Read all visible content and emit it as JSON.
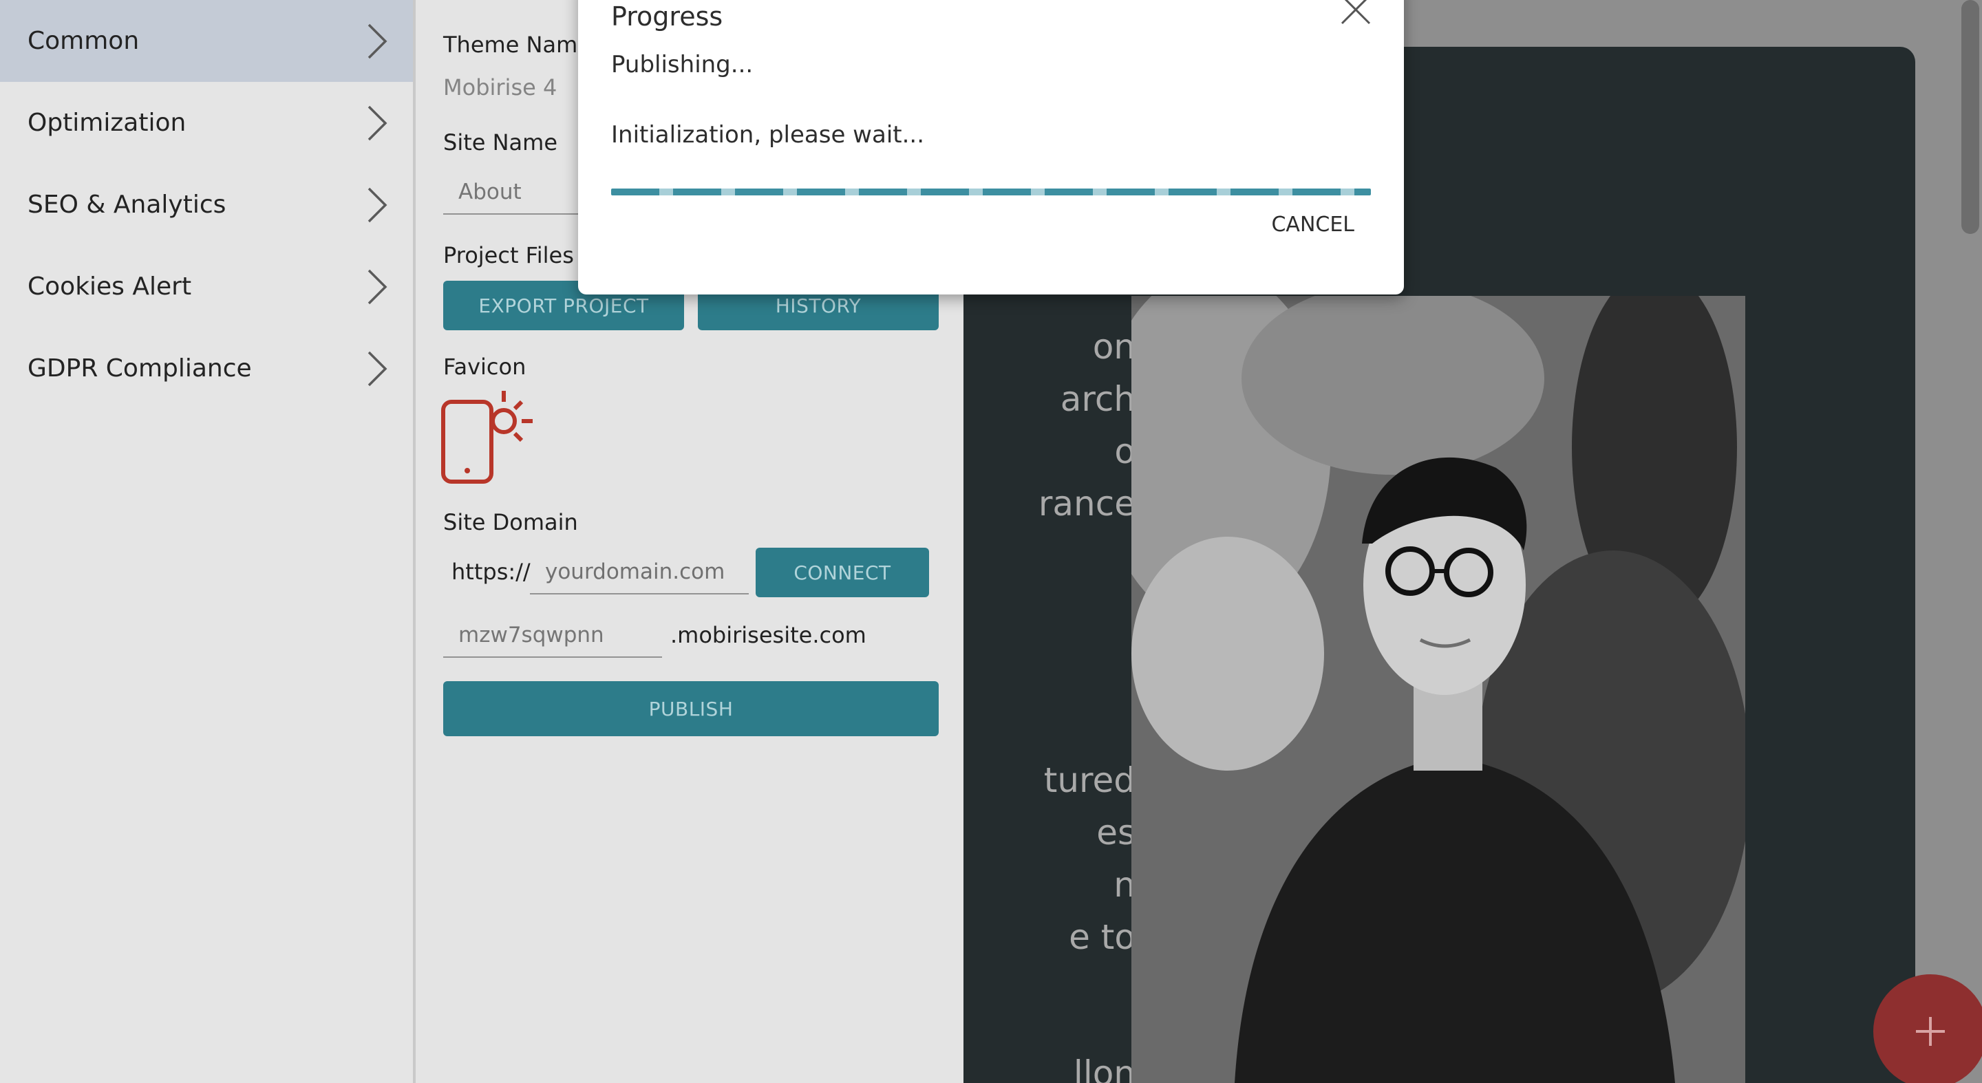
{
  "menu": {
    "items": [
      {
        "label": "Common",
        "icon": "chevron-right-icon"
      },
      {
        "label": "Optimization",
        "icon": "chevron-right-icon"
      },
      {
        "label": "SEO & Analytics",
        "icon": "chevron-right-icon"
      },
      {
        "label": "Cookies Alert",
        "icon": "chevron-right-icon"
      },
      {
        "label": "GDPR Compliance",
        "icon": "chevron-right-icon"
      }
    ],
    "active_item": "Common"
  },
  "settings": {
    "theme_name_label": "Theme Name",
    "theme_name_value": "Mobirise 4",
    "site_name_label": "Site Name",
    "site_name_value": "About",
    "project_files_label": "Project Files",
    "export_button": "EXPORT PROJECT",
    "history_button": "HISTORY",
    "favicon_label": "Favicon",
    "favicon_icon": "mobile-sun-icon",
    "site_domain_label": "Site Domain",
    "domain_prefix": "https://",
    "domain_placeholder": "yourdomain.com",
    "connect_button": "CONNECT",
    "subdomain_value": "mzw7sqwpnn",
    "subdomain_suffix": ".mobirisesite.com",
    "publish_button": "PUBLISH"
  },
  "preview": {
    "text_lines": [
      "on",
      "arch",
      "o",
      "rance",
      "tured",
      "es",
      "n",
      "e to",
      "llon"
    ]
  },
  "dialog": {
    "title": "Progress",
    "status": "Publishing...",
    "detail": "Initialization, please wait...",
    "cancel_button": "CANCEL",
    "close_icon": "close-icon"
  },
  "colors": {
    "accent": "#2f8290",
    "favicon": "#c0392b",
    "fab": "#8e2f2f",
    "progress": "#3d8fa1"
  }
}
